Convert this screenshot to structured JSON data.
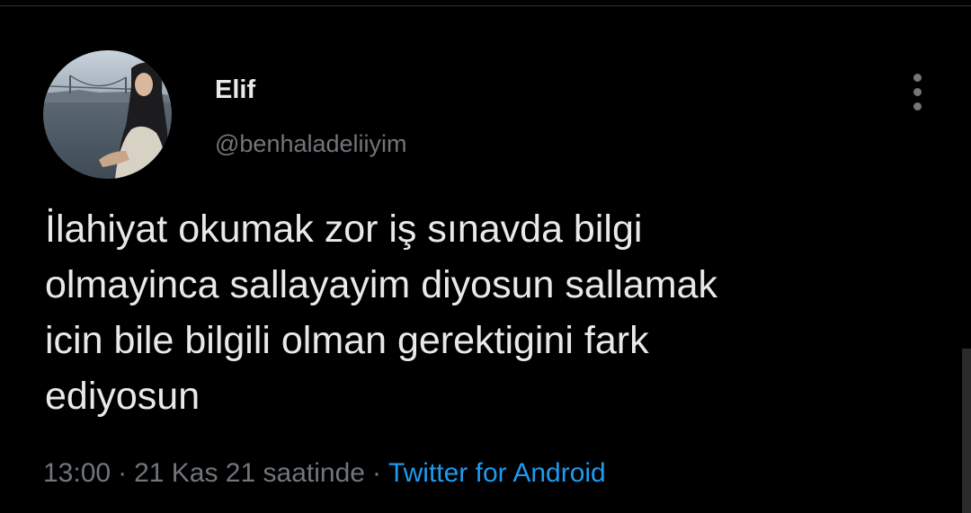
{
  "tweet": {
    "author": {
      "display_name": "Elif",
      "handle": "@benhaladeliiyim"
    },
    "text_lines": [
      "İlahiyat okumak zor iş sınavda bilgi",
      "olmayinca sallayayim diyosun sallamak",
      "icin bile bilgili olman gerektigini fark",
      "ediyosun"
    ],
    "time": "13:00",
    "date": "21 Kas 21 saatinde",
    "separator": "·",
    "source": "Twitter for Android"
  },
  "colors": {
    "background": "#000000",
    "primary_text": "#e7e9ea",
    "secondary_text": "#71767b",
    "link": "#1d9bf0"
  },
  "icons": {
    "more": "more-vertical-icon"
  }
}
